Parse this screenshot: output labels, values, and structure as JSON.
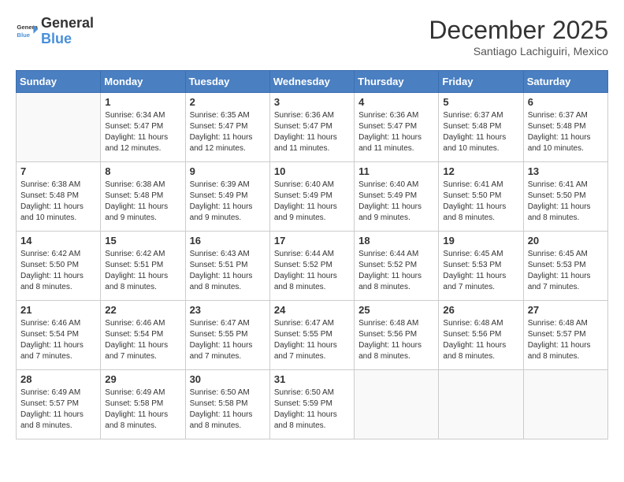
{
  "header": {
    "logo_general": "General",
    "logo_blue": "Blue",
    "month_title": "December 2025",
    "location": "Santiago Lachiguiri, Mexico"
  },
  "days_of_week": [
    "Sunday",
    "Monday",
    "Tuesday",
    "Wednesday",
    "Thursday",
    "Friday",
    "Saturday"
  ],
  "weeks": [
    [
      {
        "day": "",
        "sunrise": "",
        "sunset": "",
        "daylight": ""
      },
      {
        "day": "1",
        "sunrise": "6:34 AM",
        "sunset": "5:47 PM",
        "daylight": "11 hours and 12 minutes."
      },
      {
        "day": "2",
        "sunrise": "6:35 AM",
        "sunset": "5:47 PM",
        "daylight": "11 hours and 12 minutes."
      },
      {
        "day": "3",
        "sunrise": "6:36 AM",
        "sunset": "5:47 PM",
        "daylight": "11 hours and 11 minutes."
      },
      {
        "day": "4",
        "sunrise": "6:36 AM",
        "sunset": "5:47 PM",
        "daylight": "11 hours and 11 minutes."
      },
      {
        "day": "5",
        "sunrise": "6:37 AM",
        "sunset": "5:48 PM",
        "daylight": "11 hours and 10 minutes."
      },
      {
        "day": "6",
        "sunrise": "6:37 AM",
        "sunset": "5:48 PM",
        "daylight": "11 hours and 10 minutes."
      }
    ],
    [
      {
        "day": "7",
        "sunrise": "6:38 AM",
        "sunset": "5:48 PM",
        "daylight": "11 hours and 10 minutes."
      },
      {
        "day": "8",
        "sunrise": "6:38 AM",
        "sunset": "5:48 PM",
        "daylight": "11 hours and 9 minutes."
      },
      {
        "day": "9",
        "sunrise": "6:39 AM",
        "sunset": "5:49 PM",
        "daylight": "11 hours and 9 minutes."
      },
      {
        "day": "10",
        "sunrise": "6:40 AM",
        "sunset": "5:49 PM",
        "daylight": "11 hours and 9 minutes."
      },
      {
        "day": "11",
        "sunrise": "6:40 AM",
        "sunset": "5:49 PM",
        "daylight": "11 hours and 9 minutes."
      },
      {
        "day": "12",
        "sunrise": "6:41 AM",
        "sunset": "5:50 PM",
        "daylight": "11 hours and 8 minutes."
      },
      {
        "day": "13",
        "sunrise": "6:41 AM",
        "sunset": "5:50 PM",
        "daylight": "11 hours and 8 minutes."
      }
    ],
    [
      {
        "day": "14",
        "sunrise": "6:42 AM",
        "sunset": "5:50 PM",
        "daylight": "11 hours and 8 minutes."
      },
      {
        "day": "15",
        "sunrise": "6:42 AM",
        "sunset": "5:51 PM",
        "daylight": "11 hours and 8 minutes."
      },
      {
        "day": "16",
        "sunrise": "6:43 AM",
        "sunset": "5:51 PM",
        "daylight": "11 hours and 8 minutes."
      },
      {
        "day": "17",
        "sunrise": "6:44 AM",
        "sunset": "5:52 PM",
        "daylight": "11 hours and 8 minutes."
      },
      {
        "day": "18",
        "sunrise": "6:44 AM",
        "sunset": "5:52 PM",
        "daylight": "11 hours and 8 minutes."
      },
      {
        "day": "19",
        "sunrise": "6:45 AM",
        "sunset": "5:53 PM",
        "daylight": "11 hours and 7 minutes."
      },
      {
        "day": "20",
        "sunrise": "6:45 AM",
        "sunset": "5:53 PM",
        "daylight": "11 hours and 7 minutes."
      }
    ],
    [
      {
        "day": "21",
        "sunrise": "6:46 AM",
        "sunset": "5:54 PM",
        "daylight": "11 hours and 7 minutes."
      },
      {
        "day": "22",
        "sunrise": "6:46 AM",
        "sunset": "5:54 PM",
        "daylight": "11 hours and 7 minutes."
      },
      {
        "day": "23",
        "sunrise": "6:47 AM",
        "sunset": "5:55 PM",
        "daylight": "11 hours and 7 minutes."
      },
      {
        "day": "24",
        "sunrise": "6:47 AM",
        "sunset": "5:55 PM",
        "daylight": "11 hours and 7 minutes."
      },
      {
        "day": "25",
        "sunrise": "6:48 AM",
        "sunset": "5:56 PM",
        "daylight": "11 hours and 8 minutes."
      },
      {
        "day": "26",
        "sunrise": "6:48 AM",
        "sunset": "5:56 PM",
        "daylight": "11 hours and 8 minutes."
      },
      {
        "day": "27",
        "sunrise": "6:48 AM",
        "sunset": "5:57 PM",
        "daylight": "11 hours and 8 minutes."
      }
    ],
    [
      {
        "day": "28",
        "sunrise": "6:49 AM",
        "sunset": "5:57 PM",
        "daylight": "11 hours and 8 minutes."
      },
      {
        "day": "29",
        "sunrise": "6:49 AM",
        "sunset": "5:58 PM",
        "daylight": "11 hours and 8 minutes."
      },
      {
        "day": "30",
        "sunrise": "6:50 AM",
        "sunset": "5:58 PM",
        "daylight": "11 hours and 8 minutes."
      },
      {
        "day": "31",
        "sunrise": "6:50 AM",
        "sunset": "5:59 PM",
        "daylight": "11 hours and 8 minutes."
      },
      {
        "day": "",
        "sunrise": "",
        "sunset": "",
        "daylight": ""
      },
      {
        "day": "",
        "sunrise": "",
        "sunset": "",
        "daylight": ""
      },
      {
        "day": "",
        "sunrise": "",
        "sunset": "",
        "daylight": ""
      }
    ]
  ]
}
